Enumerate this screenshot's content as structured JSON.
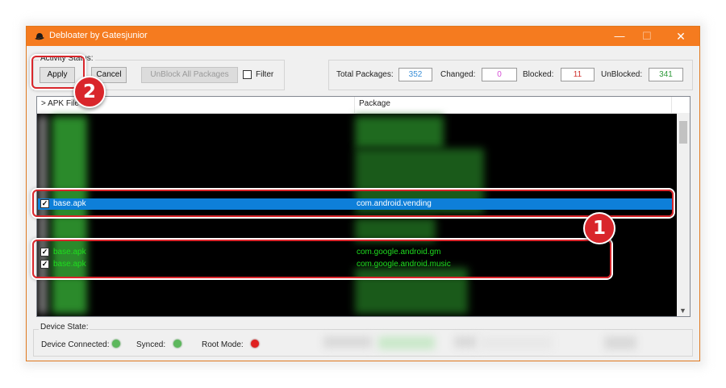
{
  "window": {
    "title": "Debloater by Gatesjunior",
    "minimize_glyph": "—",
    "maximize_glyph": "☐",
    "close_glyph": "✕",
    "app_icon": "fedora-hat-icon"
  },
  "activity": {
    "group_label": "Activity Status:",
    "apply_label": "Apply",
    "cancel_label": "Cancel",
    "unblock_all_label": "UnBlock All Packages",
    "filter_label": "Filter"
  },
  "stats": {
    "total_label": "Total Packages:",
    "total_value": "352",
    "changed_label": "Changed:",
    "changed_value": "0",
    "blocked_label": "Blocked:",
    "blocked_value": "11",
    "unblocked_label": "UnBlocked:",
    "unblocked_value": "341"
  },
  "list": {
    "col_apk": "> APK File",
    "col_package": "Package",
    "rows": [
      {
        "apk": "base.apk",
        "package": "com.android.vending",
        "checked": true,
        "selected": true
      },
      {
        "apk": "base.apk",
        "package": "com.google.android.gm",
        "checked": true,
        "selected": false
      },
      {
        "apk": "base.apk",
        "package": "com.google.android.music",
        "checked": true,
        "selected": false
      }
    ]
  },
  "device": {
    "group_label": "Device State:",
    "connected_label": "Device Connected:",
    "synced_label": "Synced:",
    "root_label": "Root Mode:"
  },
  "badges": {
    "one": "1",
    "two": "2"
  },
  "colors": {
    "title_bar": "#f57b1f",
    "list_bg": "#000000",
    "row_text": "#1edc1e",
    "selection": "#0e7fd9",
    "connected": "#5cb85c",
    "synced": "#5cb85c",
    "root": "#e02020",
    "callout": "#d9262b",
    "total_value": "#3a8fd8",
    "changed_value": "#d64fd6",
    "blocked_value": "#d0312d",
    "unblocked_value": "#2e9a3a"
  }
}
